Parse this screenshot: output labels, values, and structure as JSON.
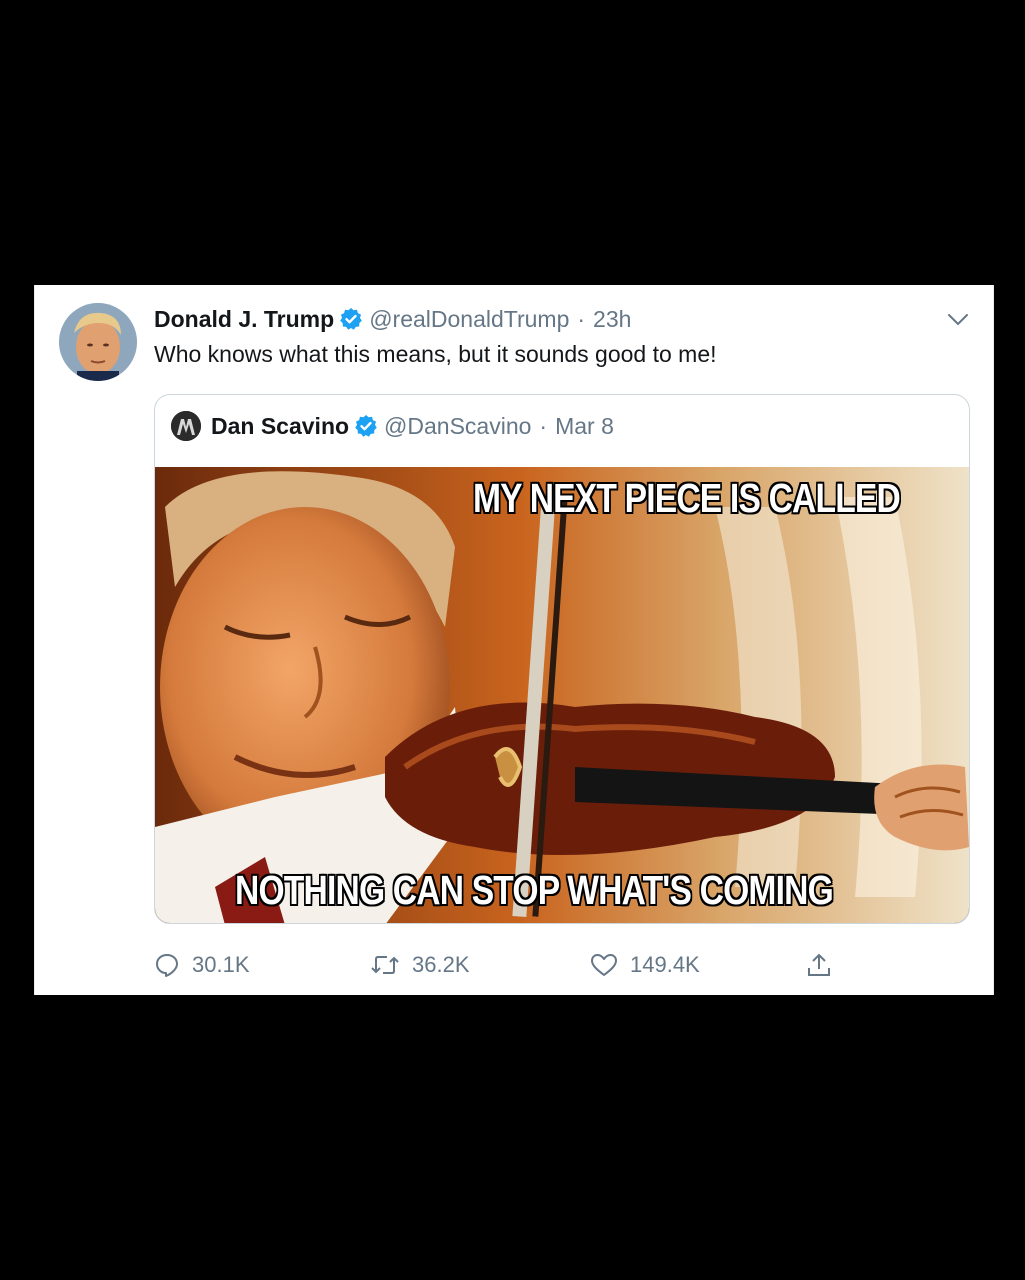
{
  "tweet": {
    "author_name": "Donald J. Trump",
    "author_handle": "@realDonaldTrump",
    "separator": "·",
    "time": "23h",
    "text": "Who knows what this means, but it sounds good to me!"
  },
  "quoted_tweet": {
    "author_name": "Dan Scavino",
    "author_handle": "@DanScavino",
    "separator": "·",
    "date": "Mar 8",
    "meme_top_text": "MY NEXT PIECE IS CALLED",
    "meme_bottom_text": "NOTHING CAN STOP WHAT'S COMING"
  },
  "actions": {
    "reply_count": "30.1K",
    "retweet_count": "36.2K",
    "like_count": "149.4K"
  },
  "colors": {
    "verified_blue": "#1da1f2",
    "muted_text": "#657786",
    "background": "#000000"
  },
  "icons": [
    "verified-badge-icon",
    "chevron-down-icon",
    "reply-icon",
    "retweet-icon",
    "like-icon",
    "share-icon"
  ]
}
